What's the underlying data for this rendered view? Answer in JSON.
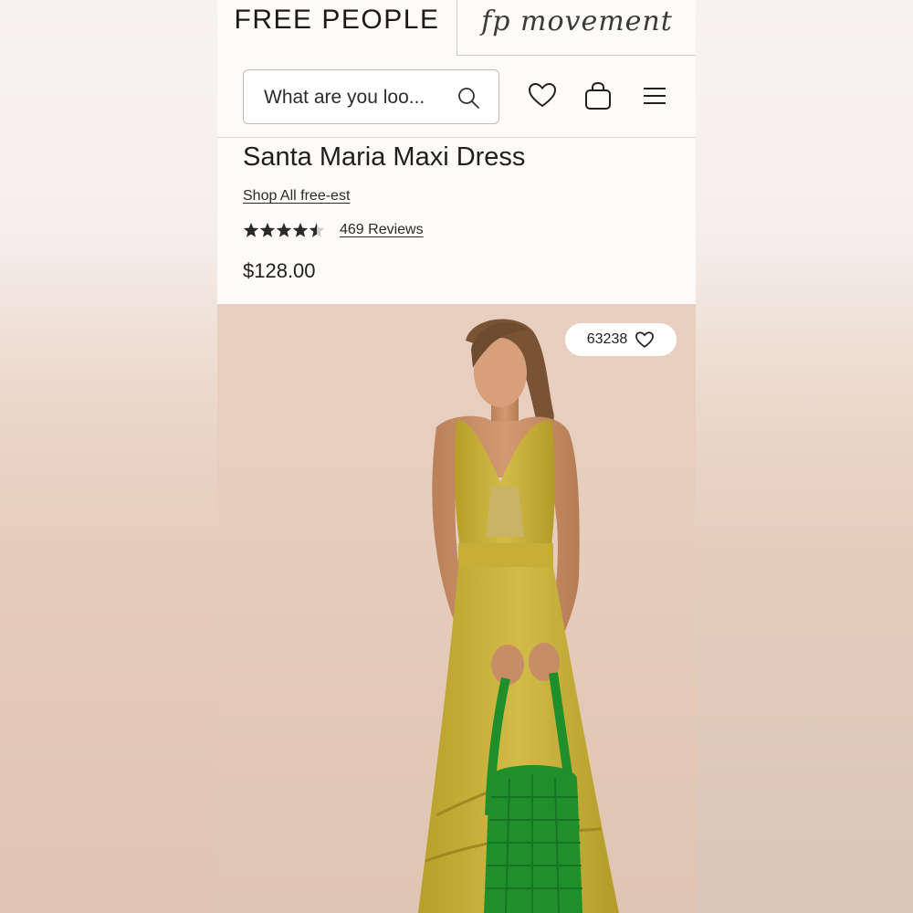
{
  "header": {
    "brand_left": "FREE PEOPLE",
    "brand_right": "fp movement"
  },
  "search": {
    "placeholder": "What are you loo..."
  },
  "icons": {
    "search": "search-icon",
    "wishlist": "heart-icon",
    "bag": "shopping-bag-icon",
    "menu": "hamburger-menu-icon"
  },
  "product": {
    "title": "Santa Maria Maxi Dress",
    "shop_link": "Shop All free-est",
    "rating": 4.5,
    "rating_max": 5,
    "reviews": "469 Reviews",
    "price": "$128.00",
    "favorites_count": "63238"
  },
  "colors": {
    "dress": "#c7b03a",
    "bag": "#1f8f2c",
    "hero_bg": "#e6cdbd",
    "text": "#1f1f1f"
  }
}
